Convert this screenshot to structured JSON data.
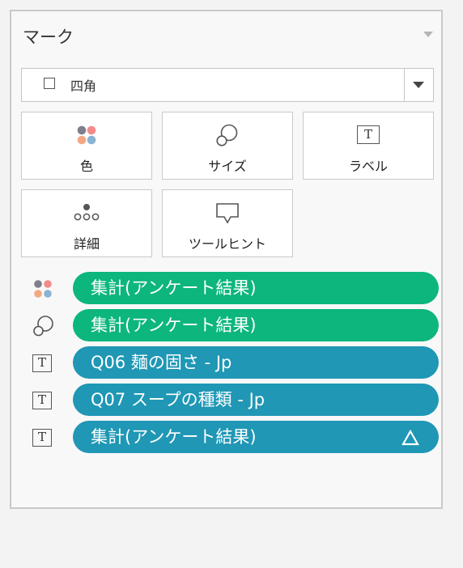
{
  "panel": {
    "title": "マーク",
    "mark_type": {
      "selected": "四角"
    },
    "cards": [
      {
        "label": "色",
        "icon": "color-dots-icon"
      },
      {
        "label": "サイズ",
        "icon": "size-circles-icon"
      },
      {
        "label": "ラベル",
        "icon": "text-label-icon"
      },
      {
        "label": "詳細",
        "icon": "detail-dots-icon"
      },
      {
        "label": "ツールヒント",
        "icon": "tooltip-icon"
      }
    ],
    "shelf": [
      {
        "label": "集計(アンケート結果)",
        "icon": "color-dots-icon",
        "color": "#0cb67c"
      },
      {
        "label": "集計(アンケート結果)",
        "icon": "size-circles-icon",
        "color": "#0cb67c"
      },
      {
        "label": "Q06 麺の固さ - Jp",
        "icon": "text-label-icon",
        "color": "#1f97b5"
      },
      {
        "label": "Q07 スープの種類 - Jp",
        "icon": "text-label-icon",
        "color": "#1f97b5"
      },
      {
        "label": "集計(アンケート結果)",
        "icon": "text-label-icon",
        "color": "#1f97b5",
        "indicator": "delta-icon"
      }
    ]
  }
}
